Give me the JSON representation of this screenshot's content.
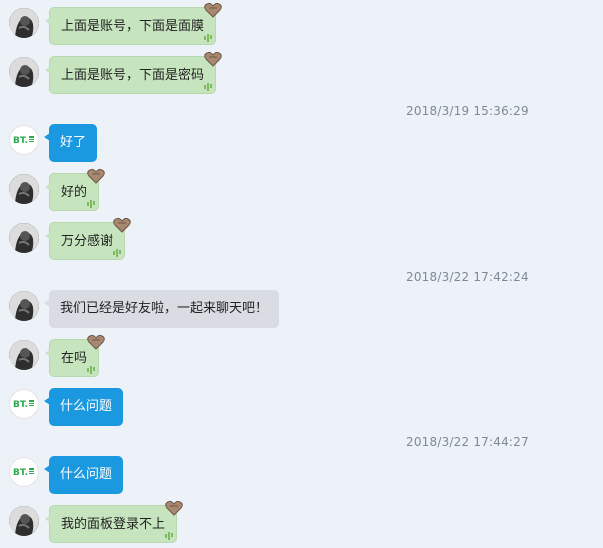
{
  "messages": [
    {
      "sender": "user",
      "text": "上面是账号，下面是面膜"
    },
    {
      "sender": "user",
      "text": "上面是账号，下面是密码"
    },
    {
      "sender": "bt",
      "text": "好了"
    },
    {
      "sender": "user",
      "text": "好的"
    },
    {
      "sender": "user",
      "text": "万分感谢"
    },
    {
      "sender": "user",
      "text": "我们已经是好友啦，一起来聊天吧！",
      "style": "system"
    },
    {
      "sender": "user",
      "text": "在吗"
    },
    {
      "sender": "bt",
      "text": "什么问题"
    },
    {
      "sender": "bt",
      "text": "什么问题"
    },
    {
      "sender": "user",
      "text": "我的面板登录不上"
    }
  ],
  "timestamps": [
    "2018/3/19 15:36:29",
    "2018/3/22 17:42:24",
    "2018/3/22 17:44:27"
  ],
  "bt_avatar_label": "BT.",
  "colors": {
    "background": "#edf2f9",
    "user_bubble": "#c6e5bf",
    "bt_bubble": "#1a98e0",
    "system_bubble": "#d9dde3",
    "timestamp": "#7d8a96"
  },
  "icons": {
    "user_avatar": "user-avatar-icon",
    "bt_avatar": "bt-logo-icon",
    "bubble_sticker": "heart-sticker-icon",
    "bubble_decor": "cactus-icon"
  }
}
